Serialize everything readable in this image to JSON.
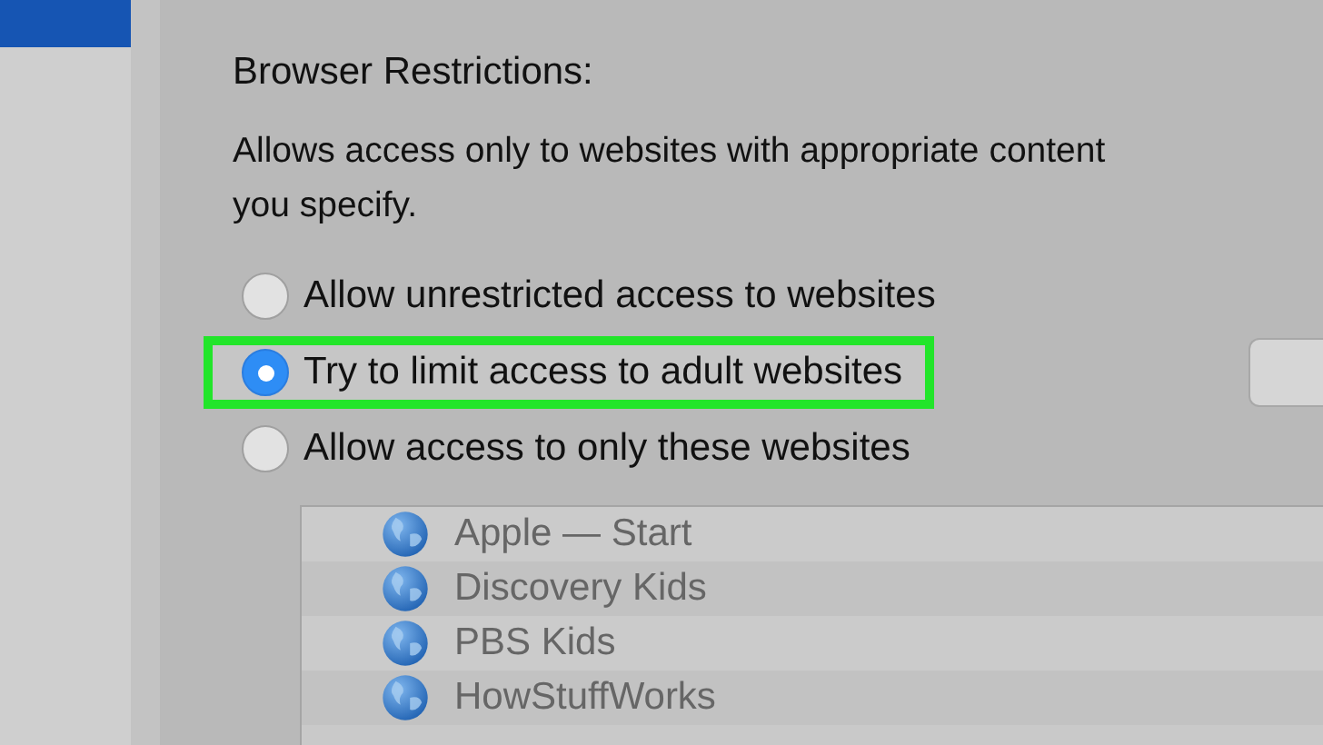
{
  "section": {
    "title": "Browser Restrictions:",
    "description": [
      "Allows access only to websites with appropriate content",
      "you specify."
    ],
    "options": [
      {
        "label": "Allow unrestricted access to websites",
        "selected": false,
        "highlighted": false
      },
      {
        "label": "Try to limit access to adult websites",
        "selected": true,
        "highlighted": true
      },
      {
        "label": "Allow access to only these websites",
        "selected": false,
        "highlighted": false
      }
    ],
    "websites": [
      {
        "name": "Apple — Start"
      },
      {
        "name": "Discovery Kids"
      },
      {
        "name": "PBS Kids"
      },
      {
        "name": "HowStuffWorks"
      }
    ]
  }
}
